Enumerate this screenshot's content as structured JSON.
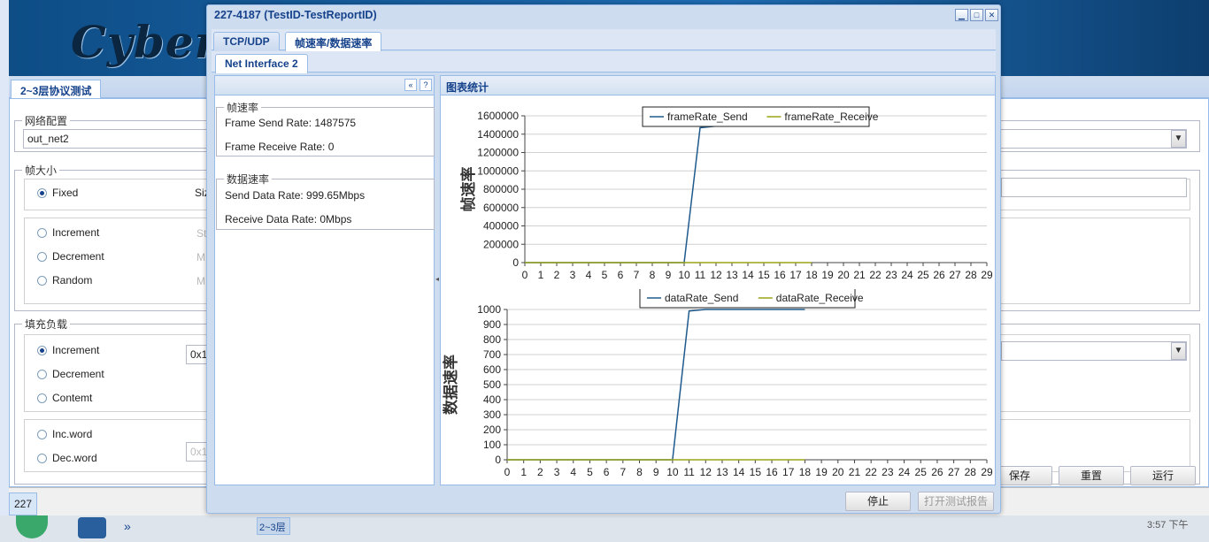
{
  "background_app": {
    "logo_text": "Cyberr",
    "tab_label": "2~3层协议测试",
    "network_config": {
      "legend": "网络配置",
      "value": "out_net2"
    },
    "frame_size": {
      "legend": "帧大小",
      "fixed": "Fixed",
      "size_label_partial": "Siz",
      "increment": "Increment",
      "decrement": "Decrement",
      "random": "Random",
      "hint1": "St",
      "hint2": "M",
      "hint3": "M"
    },
    "payload": {
      "legend": "填充负载",
      "increment": "Increment",
      "decrement": "Decrement",
      "contemt": "Contemt",
      "value_partial": "0x1",
      "inc_word": "Inc.word",
      "dec_word": "Dec.word",
      "value2_partial": "0x1"
    },
    "buttons": {
      "save": "保存",
      "reset": "重置",
      "run": "运行"
    },
    "status_cell": "227",
    "taskbar": {
      "item": "2~3层",
      "chevron": "»",
      "time_partial": "3:57 下午"
    }
  },
  "dialog": {
    "title": "227-4187 (TestID-TestReportID)",
    "tabs": [
      "TCP/UDP",
      "帧速率/数据速率"
    ],
    "active_tab": 1,
    "subtab": "Net Interface 2",
    "left_panel": {
      "frame_rate_legend": "帧速率",
      "frame_send_rate": "Frame Send Rate: 1487575",
      "frame_receive_rate": "Frame Receive Rate: 0",
      "data_rate_legend": "数据速率",
      "send_data_rate": "Send Data Rate: 999.65Mbps",
      "receive_data_rate": "Receive Data Rate: 0Mbps"
    },
    "right_panel_title": "图表统计",
    "buttons": {
      "stop": "停止",
      "open_report": "打开测试报告"
    }
  },
  "colors": {
    "send": "#1f5a8c",
    "receive": "#9aa316",
    "accent": "#15428b",
    "grid": "#d0d0d0"
  },
  "chart_data": [
    {
      "type": "line",
      "title": "",
      "ylabel": "帧速率",
      "xlabel": "",
      "x": [
        0,
        1,
        2,
        3,
        4,
        5,
        6,
        7,
        8,
        9,
        10,
        11,
        12,
        13,
        14,
        15,
        16,
        17,
        18
      ],
      "xticks": [
        0,
        1,
        2,
        3,
        4,
        5,
        6,
        7,
        8,
        9,
        10,
        11,
        12,
        13,
        14,
        15,
        16,
        17,
        18,
        19,
        20,
        21,
        22,
        23,
        24,
        25,
        26,
        27,
        28,
        29
      ],
      "xlim": [
        0,
        29
      ],
      "ylim": [
        0,
        1600000
      ],
      "yticks": [
        0,
        200000,
        400000,
        600000,
        800000,
        1000000,
        1200000,
        1400000,
        1600000
      ],
      "legend": "top-center",
      "series": [
        {
          "name": "frameRate_Send",
          "values": [
            0,
            0,
            0,
            0,
            0,
            0,
            0,
            0,
            0,
            0,
            0,
            1470000,
            1487575,
            1487575,
            1487575,
            1487575,
            1487575,
            1487575,
            1487575
          ]
        },
        {
          "name": "frameRate_Receive",
          "values": [
            0,
            0,
            0,
            0,
            0,
            0,
            0,
            0,
            0,
            0,
            0,
            0,
            0,
            0,
            0,
            0,
            0,
            0,
            0
          ]
        }
      ]
    },
    {
      "type": "line",
      "title": "",
      "ylabel": "数据速率",
      "xlabel": "",
      "x": [
        0,
        1,
        2,
        3,
        4,
        5,
        6,
        7,
        8,
        9,
        10,
        11,
        12,
        13,
        14,
        15,
        16,
        17,
        18
      ],
      "xticks": [
        0,
        1,
        2,
        3,
        4,
        5,
        6,
        7,
        8,
        9,
        10,
        11,
        12,
        13,
        14,
        15,
        16,
        17,
        18,
        19,
        20,
        21,
        22,
        23,
        24,
        25,
        26,
        27,
        28,
        29
      ],
      "xlim": [
        0,
        29
      ],
      "ylim": [
        0,
        1000
      ],
      "yticks": [
        0,
        100,
        200,
        300,
        400,
        500,
        600,
        700,
        800,
        900,
        1000
      ],
      "legend": "top-center",
      "series": [
        {
          "name": "dataRate_Send",
          "values": [
            0,
            0,
            0,
            0,
            0,
            0,
            0,
            0,
            0,
            0,
            0,
            990,
            999.65,
            999.65,
            999.65,
            999.65,
            999.65,
            999.65,
            999.65
          ]
        },
        {
          "name": "dataRate_Receive",
          "values": [
            0,
            0,
            0,
            0,
            0,
            0,
            0,
            0,
            0,
            0,
            0,
            0,
            0,
            0,
            0,
            0,
            0,
            0,
            0
          ]
        }
      ]
    }
  ]
}
